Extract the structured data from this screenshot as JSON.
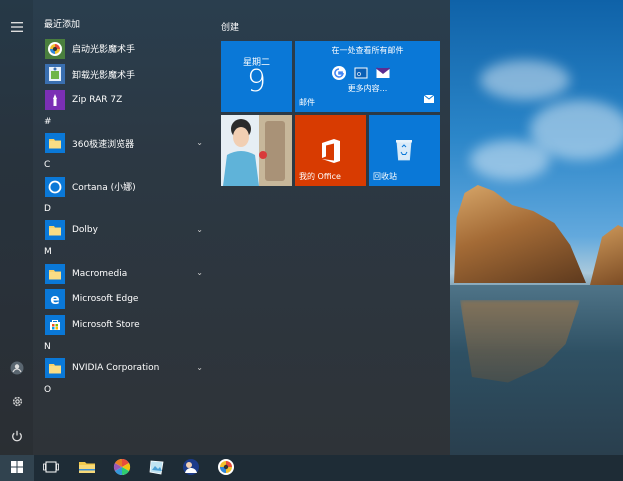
{
  "start_menu": {
    "recent_header": "最近添加",
    "apps": [
      {
        "label": "启动光影魔术手",
        "icon": "nevis-launcher-icon",
        "chevron": false
      },
      {
        "label": "卸载光影魔术手",
        "icon": "uninstall-icon",
        "chevron": false
      },
      {
        "label": "Zip RAR 7Z",
        "icon": "zip-icon",
        "chevron": false
      },
      {
        "header": "#"
      },
      {
        "label": "360极速浏览器",
        "icon": "folder-icon",
        "chevron": true
      },
      {
        "header": "C"
      },
      {
        "label": "Cortana (小娜)",
        "icon": "cortana-icon",
        "chevron": false
      },
      {
        "header": "D"
      },
      {
        "label": "Dolby",
        "icon": "folder-icon",
        "chevron": true
      },
      {
        "header": "M"
      },
      {
        "label": "Macromedia",
        "icon": "folder-icon",
        "chevron": true
      },
      {
        "label": "Microsoft Edge",
        "icon": "edge-icon",
        "chevron": false
      },
      {
        "label": "Microsoft Store",
        "icon": "store-icon",
        "chevron": false
      },
      {
        "header": "N"
      },
      {
        "label": "NVIDIA Corporation",
        "icon": "folder-icon",
        "chevron": true
      },
      {
        "header": "O"
      }
    ],
    "tiles_header": "创建",
    "tiles": {
      "calendar": {
        "weekday": "星期二",
        "day": "9"
      },
      "mail": {
        "title": "在一处查看所有邮件",
        "more": "更多内容...",
        "label": "邮件"
      },
      "office": {
        "label": "我的 Office"
      },
      "recycle": {
        "label": "回收站"
      }
    }
  },
  "colors": {
    "tile_blue": "#0a78d7",
    "office_orange": "#d83b01",
    "menu_bg": "#2c3843"
  }
}
